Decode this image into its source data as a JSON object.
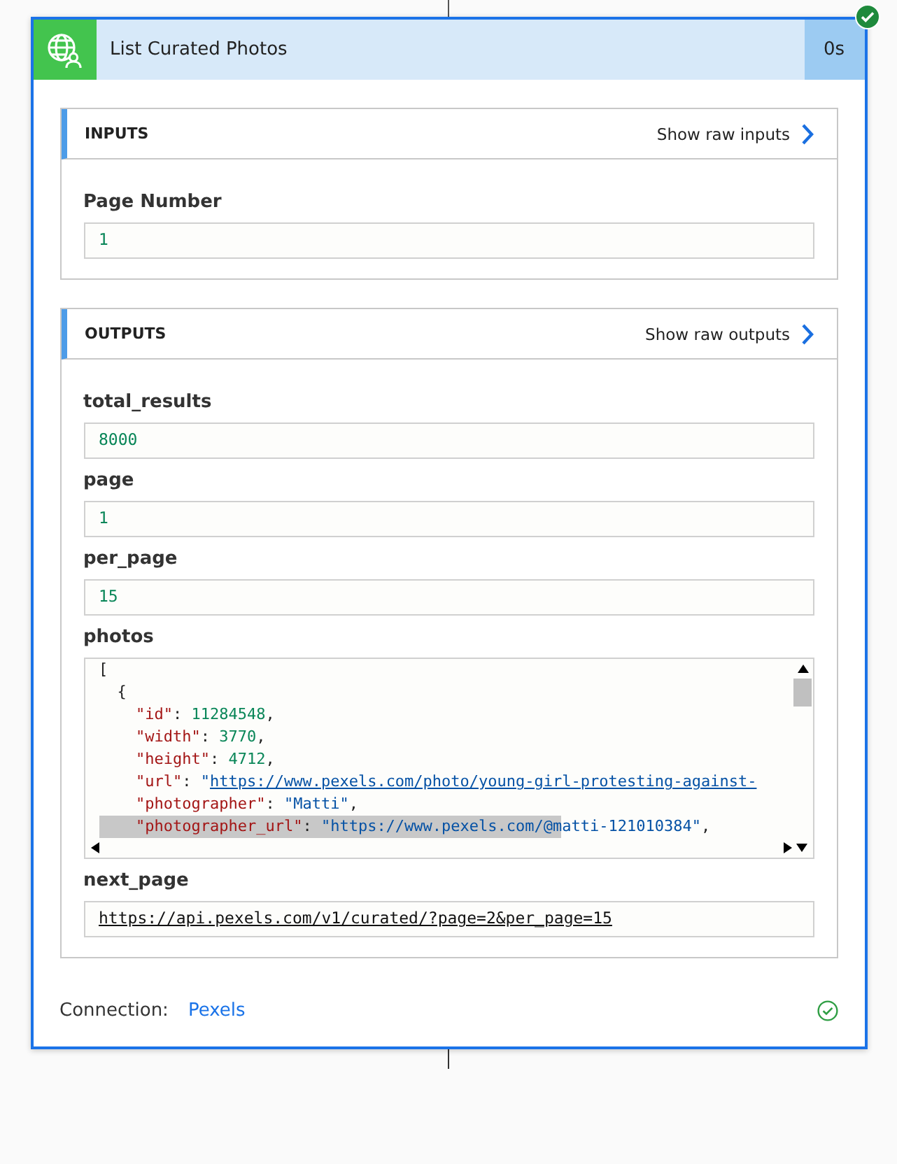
{
  "action": {
    "title": "List Curated Photos",
    "duration": "0s",
    "succeeded": true
  },
  "sections": [
    {
      "title": "INPUTS",
      "raw_link": "Show raw inputs",
      "fields": [
        {
          "label": "Page Number",
          "kind": "value",
          "value": "1"
        }
      ]
    },
    {
      "title": "OUTPUTS",
      "raw_link": "Show raw outputs",
      "fields": [
        {
          "label": "total_results",
          "kind": "value",
          "value": "8000"
        },
        {
          "label": "page",
          "kind": "value",
          "value": "1"
        },
        {
          "label": "per_page",
          "kind": "value",
          "value": "15"
        },
        {
          "label": "photos",
          "kind": "code",
          "lines": [
            {
              "selected": false,
              "tokens": [
                {
                  "kind": "punct",
                  "text": "["
                }
              ]
            },
            {
              "selected": false,
              "tokens": [
                {
                  "kind": "punct",
                  "text": "  {"
                }
              ]
            },
            {
              "selected": false,
              "tokens": [
                {
                  "kind": "key",
                  "text": "    \"id\""
                },
                {
                  "kind": "punct",
                  "text": ": "
                },
                {
                  "kind": "number",
                  "text": "11284548"
                },
                {
                  "kind": "punct",
                  "text": ","
                }
              ]
            },
            {
              "selected": false,
              "tokens": [
                {
                  "kind": "key",
                  "text": "    \"width\""
                },
                {
                  "kind": "punct",
                  "text": ": "
                },
                {
                  "kind": "number",
                  "text": "3770"
                },
                {
                  "kind": "punct",
                  "text": ","
                }
              ]
            },
            {
              "selected": false,
              "tokens": [
                {
                  "kind": "key",
                  "text": "    \"height\""
                },
                {
                  "kind": "punct",
                  "text": ": "
                },
                {
                  "kind": "number",
                  "text": "4712"
                },
                {
                  "kind": "punct",
                  "text": ","
                }
              ]
            },
            {
              "selected": false,
              "tokens": [
                {
                  "kind": "key",
                  "text": "    \"url\""
                },
                {
                  "kind": "punct",
                  "text": ": "
                },
                {
                  "kind": "string",
                  "text": "\""
                },
                {
                  "kind": "link",
                  "text": "https://www.pexels.com/photo/young-girl-protesting-against-"
                }
              ]
            },
            {
              "selected": false,
              "tokens": [
                {
                  "kind": "key",
                  "text": "    \"photographer\""
                },
                {
                  "kind": "punct",
                  "text": ": "
                },
                {
                  "kind": "string",
                  "text": "\"Matti\""
                },
                {
                  "kind": "punct",
                  "text": ","
                }
              ]
            },
            {
              "selected": true,
              "tokens": [
                {
                  "kind": "key",
                  "text": "    \"photographer_url\""
                },
                {
                  "kind": "punct",
                  "text": ": "
                },
                {
                  "kind": "string",
                  "text": "\"https://www.pexels.com/@matti-121010384\""
                },
                {
                  "kind": "punct",
                  "text": ","
                }
              ]
            }
          ]
        },
        {
          "label": "next_page",
          "kind": "link",
          "value": "https://api.pexels.com/v1/curated/?page=2&per_page=15"
        }
      ]
    }
  ],
  "connection": {
    "label": "Connection:",
    "name": "Pexels",
    "ok": true
  }
}
